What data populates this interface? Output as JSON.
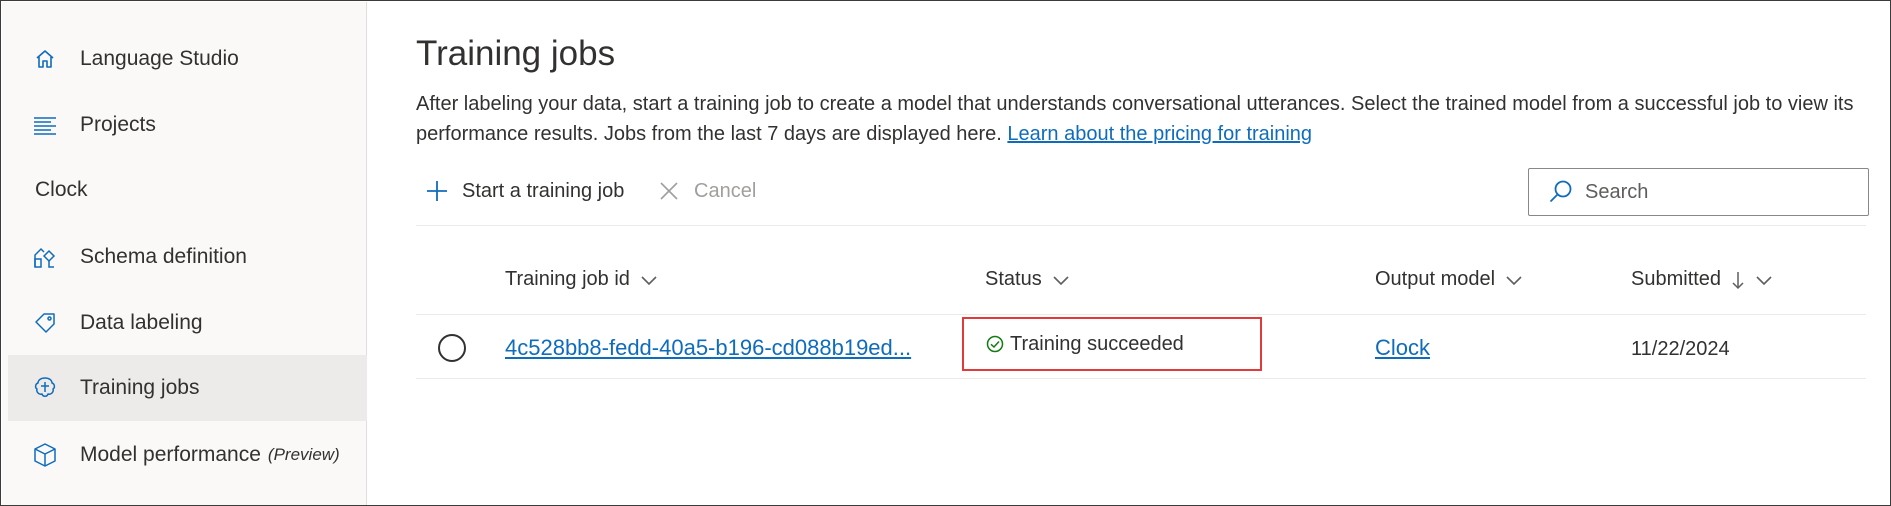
{
  "sidebar": {
    "items": [
      {
        "label": "Language Studio",
        "icon": "home-icon"
      },
      {
        "label": "Projects",
        "icon": "list-icon"
      },
      {
        "label": "Schema definition",
        "icon": "schema-icon"
      },
      {
        "label": "Data labeling",
        "icon": "tag-icon"
      },
      {
        "label": "Training jobs",
        "icon": "brain-icon",
        "selected": true
      },
      {
        "label": "Model performance",
        "suffix": "(Preview)",
        "icon": "cube-icon"
      }
    ],
    "section_label": "Clock"
  },
  "main": {
    "title": "Training jobs",
    "description": "After labeling your data, start a training job to create a model that understands conversational utterances. Select the trained model from a successful job to view its performance results. Jobs from the last 7 days are displayed here.",
    "pricing_link": "Learn about the pricing for training",
    "toolbar": {
      "start_label": "Start a training job",
      "cancel_label": "Cancel"
    },
    "search": {
      "placeholder": "Search",
      "value": ""
    },
    "table": {
      "columns": [
        "Training job id",
        "Status",
        "Output model",
        "Submitted"
      ],
      "rows": [
        {
          "job_id": "4c528bb8-fedd-40a5-b196-cd088b19ed...",
          "status": "Training succeeded",
          "output_model": "Clock",
          "submitted": "11/22/2024"
        }
      ]
    }
  },
  "colors": {
    "accent": "#0f6cbd",
    "success": "#107c10",
    "highlight_border": "#e03a3a",
    "sidebar_bg": "#faf9f8",
    "selected_bg": "#edebe9"
  }
}
